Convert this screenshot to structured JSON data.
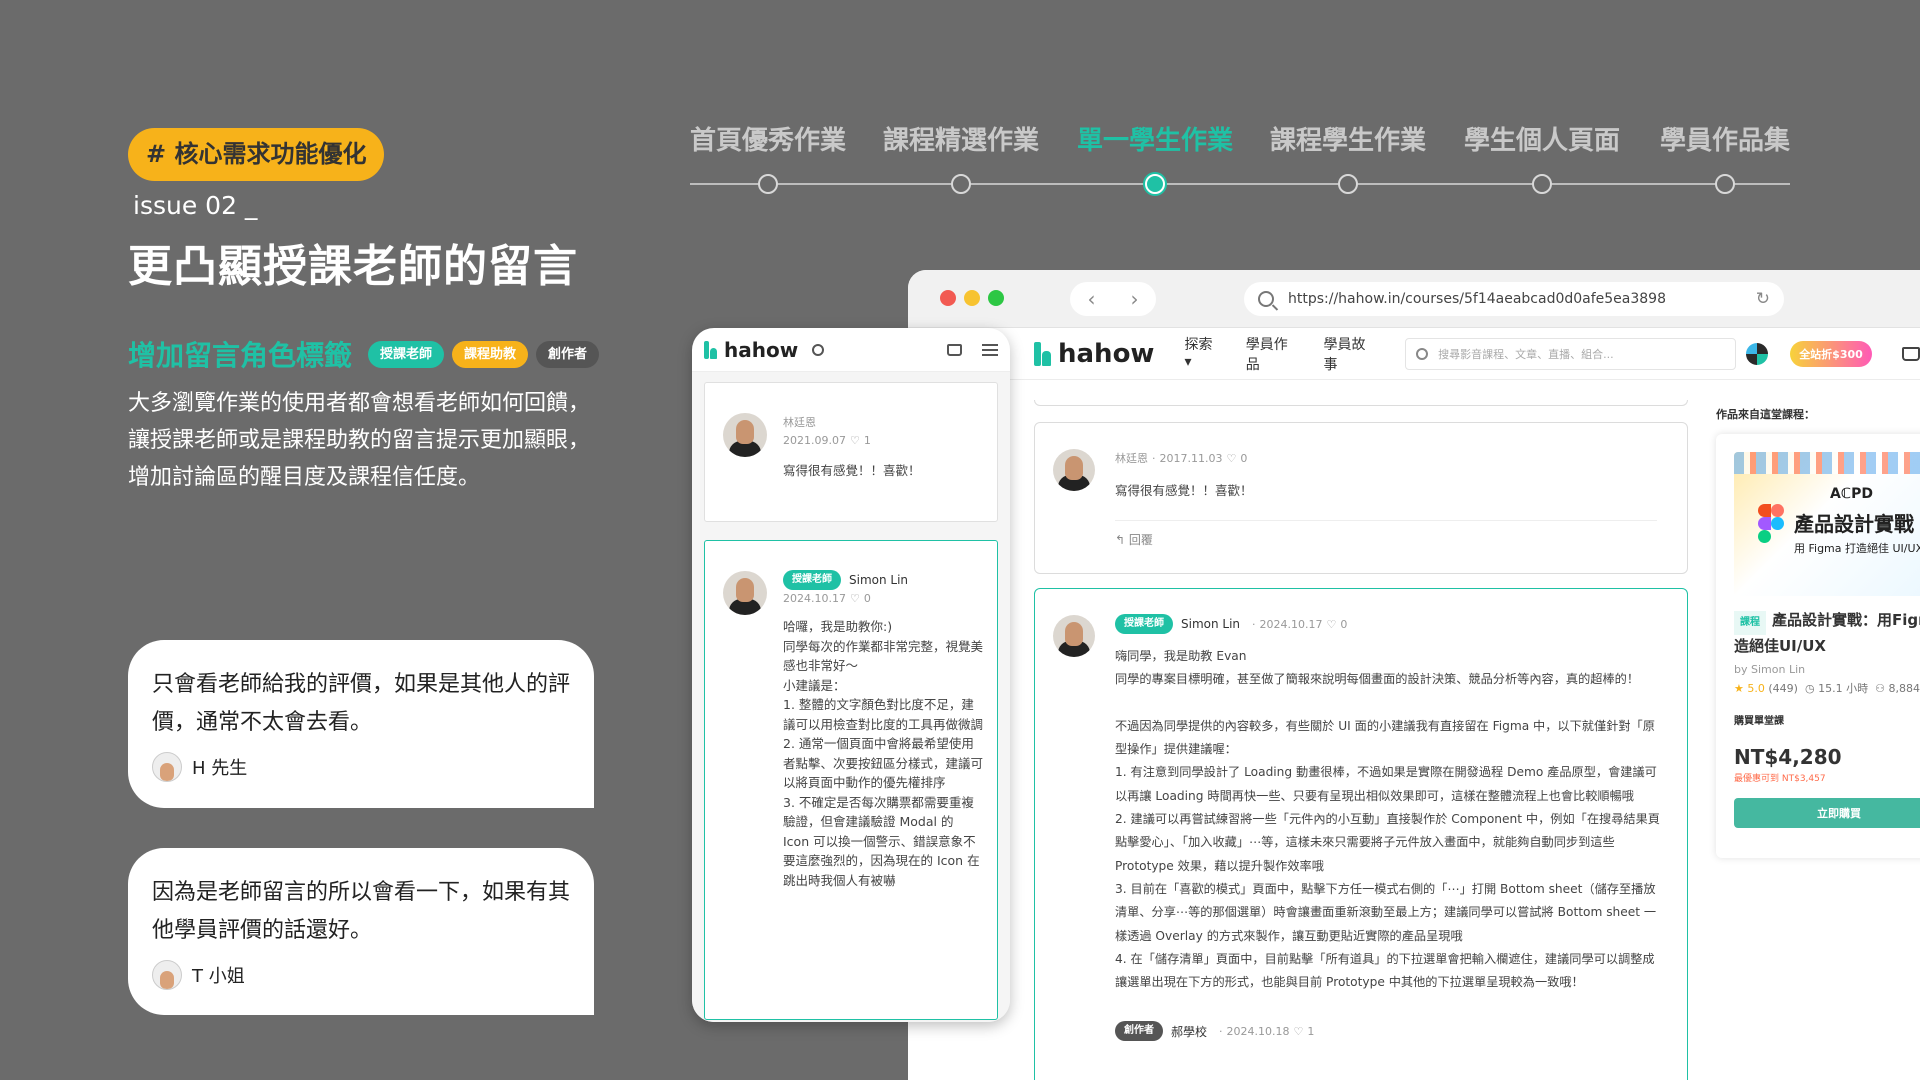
{
  "left": {
    "tag": "# 核心需求功能優化",
    "issue": "issue 02 _",
    "headline": "更凸顯授課老師的留言",
    "subhead": "增加留言角色標籤",
    "badges": [
      "授課老師",
      "課程助教",
      "創作者"
    ],
    "description": "大多瀏覽作業的使用者都會想看老師如何回饋，讓授課老師或是課程助教的留言提示更加顯眼，增加討論區的醒目度及課程信任度。",
    "quotes": [
      {
        "text": "只會看老師給我的評價，如果是其他人的評價，通常不太會去看。",
        "author": "H 先生"
      },
      {
        "text": "因為是老師留言的所以會看一下，如果有其他學員評價的話還好。",
        "author": "T 小姐"
      }
    ]
  },
  "timeline": {
    "items": [
      "首頁優秀作業",
      "課程精選作業",
      "單一學生作業",
      "課程學生作業",
      "學生個人頁面",
      "學員作品集"
    ],
    "active": "單一學生作業"
  },
  "browser": {
    "url": "https://hahow.in/courses/5f14aeabcad0d0afe5ea3898",
    "logo": "hahow",
    "menu": [
      "探索 ▾",
      "學員作品",
      "學員故事"
    ],
    "search_placeholder": "搜尋影音課程、文章、直播、組合...",
    "promo": "全站折$300",
    "comments": [
      {
        "name": "林廷恩",
        "date": "2017.11.03",
        "likes": "0",
        "text": "寫得很有感覺！！喜歡！",
        "reply": "回覆"
      },
      {
        "badge": "授課老師",
        "name": "Simon Lin",
        "date": "2024.10.17",
        "likes": "0",
        "text": "嗨同學，我是助教 Evan\n同學的專案目標明確，甚至做了簡報來說明每個畫面的設計決策、競品分析等內容，真的超棒的！\n\n不過因為同學提供的內容較多，有些關於 UI 面的小建議我有直接留在 Figma 中，以下就僅針對「原型操作」提供建議喔：\n1. 有注意到同學設計了 Loading 動畫很棒，不過如果是實際在開發過程 Demo 產品原型，會建議可以再讓 Loading 時間再快一些、只要有呈現出相似效果即可，這樣在整體流程上也會比較順暢哦\n2. 建議可以再嘗試練習將一些「元件內的小互動」直接製作於 Component 中，例如「在搜尋結果頁點擊愛心」、「加入收藏」⋯等，這樣未來只需要將子元件放入畫面中，就能夠自動同步到這些 Prototype 效果，藉以提升製作效率哦\n3. 目前在「喜歡的模式」頁面中，點擊下方任一模式右側的「⋯」打開 Bottom sheet（儲存至播放清單、分享⋯等的那個選單）時會讓畫面重新滾動至最上方；建議同學可以嘗試將 Bottom sheet 一樣透過 Overlay 的方式來製作，讓互動更貼近實際的產品呈現哦\n4. 在「儲存清單」頁面中，目前點擊「所有道具」的下拉選單會把輸入欄遮住，建議同學可以調整成讓選單出現在下方的形式，也能與目前 Prototype 中其他的下拉選單呈現較為一致哦！"
      },
      {
        "badge": "創作者",
        "name": "郝學校",
        "date": "2024.10.18",
        "likes": "1"
      }
    ],
    "sidebar": {
      "title": "作品來自這堂課程：",
      "thumb_logo": "AℂPD",
      "thumb_big": "產品設計實戰",
      "thumb_small": "用 Figma 打造絕佳 UI/UX",
      "course_tag": "課程",
      "course_title": "產品設計實戰：用Figma",
      "course_title_2": "造絕佳UI/UX",
      "by": "by Simon Lin",
      "rating": "5.0",
      "rating_count": "(449)",
      "hours": "15.1 小時",
      "students": "8,884",
      "buy_label": "購買單堂課",
      "price": "NT$4,280",
      "discount": "最優惠可到 NT$3,457",
      "buy_button": "立即購買"
    }
  },
  "mobile": {
    "logo": "hahow",
    "comments": [
      {
        "name": "林廷恩",
        "date": "2021.09.07",
        "likes": "1",
        "text": "寫得很有感覺！！喜歡！"
      },
      {
        "badge": "授課老師",
        "name": "Simon Lin",
        "date": "2024.10.17",
        "likes": "0",
        "text": "哈囉，我是助教你:)\n同學每次的作業都非常完整，視覺美感也非常好～\n小建議是：\n1. 整體的文字顏色對比度不足，建議可以用檢查對比度的工具再做微調\n2. 通常一個頁面中會將最希望使用者點擊、次要按鈕區分樣式，建議可以將頁面中動作的優先權排序\n3. 不確定是否每次購票都需要重複驗證，但會建議驗證 Modal 的 Icon 可以換一個警示、錯誤意象不要這麼強烈的，因為現在的 Icon 在跳出時我個人有被嚇"
      }
    ]
  },
  "colors": {
    "accent": "#1fc1a5",
    "tag": "#f7b21a",
    "background": "#6b6b6b"
  }
}
